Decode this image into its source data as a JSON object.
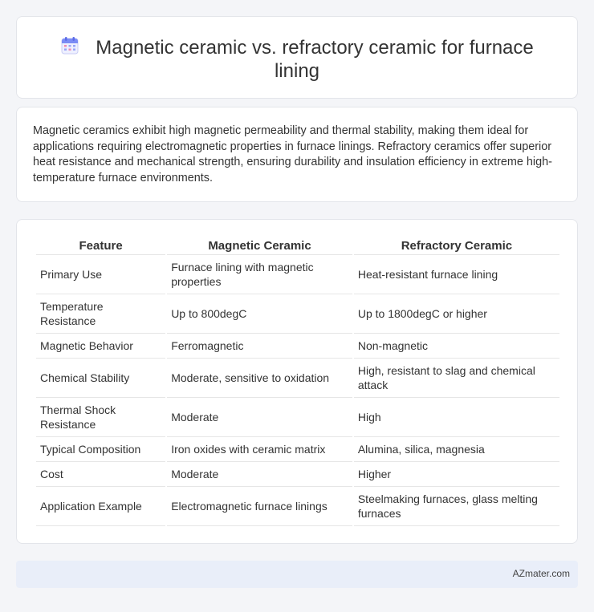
{
  "header": {
    "title": "Magnetic ceramic vs. refractory ceramic for furnace lining",
    "icon": "calendar-icon"
  },
  "intro": {
    "text": "Magnetic ceramics exhibit high magnetic permeability and thermal stability, making them ideal for applications requiring electromagnetic properties in furnace linings. Refractory ceramics offer superior heat resistance and mechanical strength, ensuring durability and insulation efficiency in extreme high-temperature furnace environments."
  },
  "table": {
    "headers": [
      "Feature",
      "Magnetic Ceramic",
      "Refractory Ceramic"
    ],
    "rows": [
      [
        "Primary Use",
        "Furnace lining with magnetic properties",
        "Heat-resistant furnace lining"
      ],
      [
        "Temperature Resistance",
        "Up to 800degC",
        "Up to 1800degC or higher"
      ],
      [
        "Magnetic Behavior",
        "Ferromagnetic",
        "Non-magnetic"
      ],
      [
        "Chemical Stability",
        "Moderate, sensitive to oxidation",
        "High, resistant to slag and chemical attack"
      ],
      [
        "Thermal Shock Resistance",
        "Moderate",
        "High"
      ],
      [
        "Typical Composition",
        "Iron oxides with ceramic matrix",
        "Alumina, silica, magnesia"
      ],
      [
        "Cost",
        "Moderate",
        "Higher"
      ],
      [
        "Application Example",
        "Electromagnetic furnace linings",
        "Steelmaking furnaces, glass melting furnaces"
      ]
    ]
  },
  "footer": {
    "brand": "AZmater.com"
  }
}
